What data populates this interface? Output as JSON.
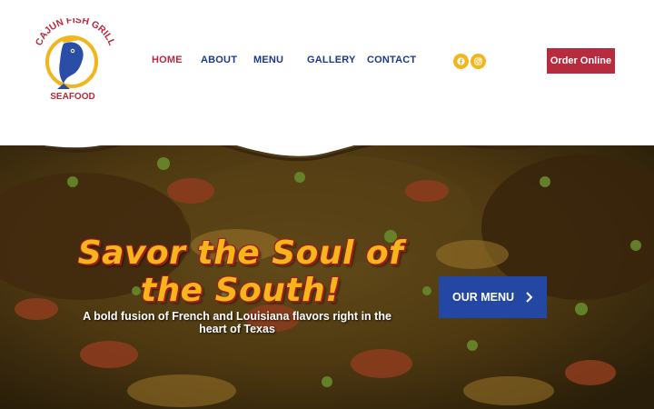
{
  "brand": {
    "logo_top_text": "CAJUN FISH GRILL",
    "logo_bottom_text": "SEAFOOD",
    "colors": {
      "red": "#b72b3e",
      "navy": "#1d3a8a",
      "gold": "#f2b51b",
      "blue_button": "#2447a3"
    }
  },
  "nav": {
    "items": [
      {
        "label": "HOME",
        "active": true
      },
      {
        "label": "ABOUT",
        "active": false
      },
      {
        "label": "MENU",
        "active": false
      },
      {
        "label": "GALLERY",
        "active": false
      },
      {
        "label": "CONTACT",
        "active": false
      }
    ]
  },
  "social": [
    {
      "icon": "facebook-icon"
    },
    {
      "icon": "instagram-icon"
    }
  ],
  "header": {
    "order_button": "Order Online"
  },
  "hero": {
    "headline_line1": "Savor the Soul of",
    "headline_line2": "the South!",
    "subline": "A bold fusion of French and Louisiana flavors right in the heart of Texas",
    "cta_label": "OUR MENU",
    "cta_icon": "chevron-right-icon"
  }
}
